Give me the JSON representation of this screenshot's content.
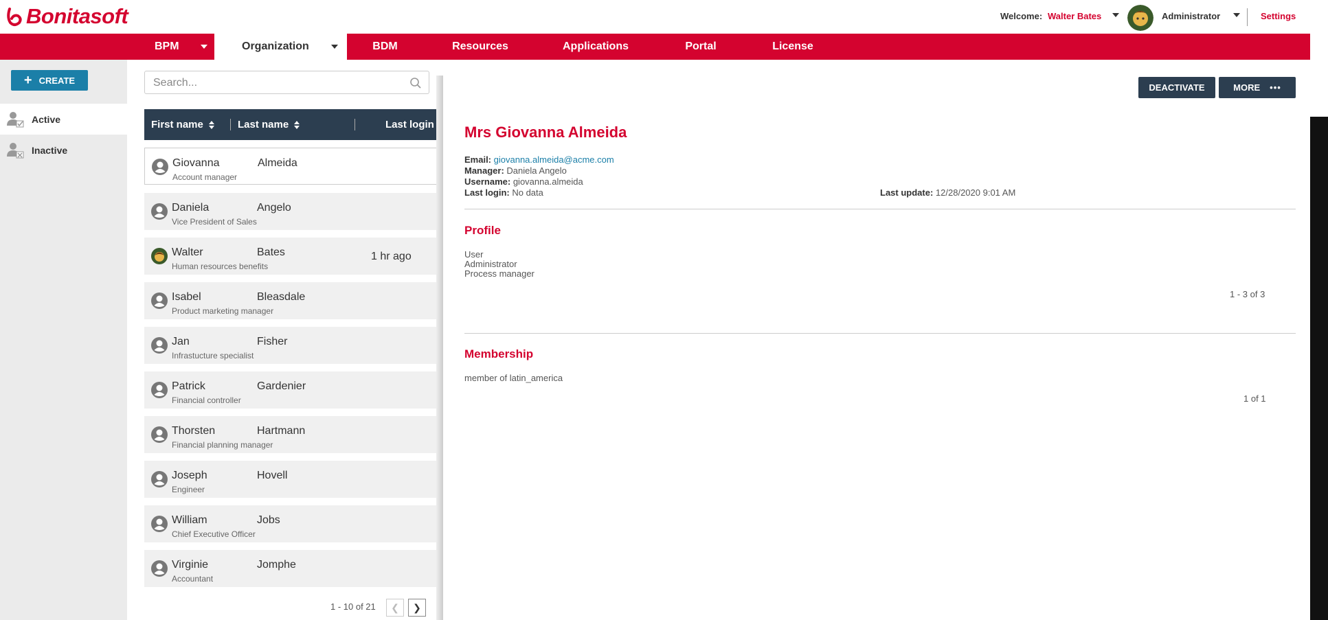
{
  "header": {
    "logo_text": "Bonitasoft",
    "welcome_label": "Welcome:",
    "welcome_user": "Walter Bates",
    "role": "Administrator",
    "settings": "Settings"
  },
  "nav": {
    "items": [
      {
        "label": "BPM"
      },
      {
        "label": "Organization"
      },
      {
        "label": "BDM"
      },
      {
        "label": "Resources"
      },
      {
        "label": "Applications"
      },
      {
        "label": "Portal"
      },
      {
        "label": "License"
      }
    ]
  },
  "sidebar": {
    "create_label": "CREATE",
    "items": [
      {
        "label": "Active"
      },
      {
        "label": "Inactive"
      }
    ]
  },
  "search": {
    "placeholder": "Search...",
    "value": ""
  },
  "table": {
    "columns": [
      "First name",
      "Last name",
      "Last login"
    ],
    "rows": [
      {
        "first": "Giovanna",
        "last": "Almeida",
        "job": "Account manager",
        "last_login": ""
      },
      {
        "first": "Daniela",
        "last": "Angelo",
        "job": "Vice President of Sales",
        "last_login": ""
      },
      {
        "first": "Walter",
        "last": "Bates",
        "job": "Human resources benefits",
        "last_login": "1 hr ago"
      },
      {
        "first": "Isabel",
        "last": "Bleasdale",
        "job": "Product marketing manager",
        "last_login": ""
      },
      {
        "first": "Jan",
        "last": "Fisher",
        "job": "Infrastucture specialist",
        "last_login": ""
      },
      {
        "first": "Patrick",
        "last": "Gardenier",
        "job": "Financial controller",
        "last_login": ""
      },
      {
        "first": "Thorsten",
        "last": "Hartmann",
        "job": "Financial planning manager",
        "last_login": ""
      },
      {
        "first": "Joseph",
        "last": "Hovell",
        "job": "Engineer",
        "last_login": ""
      },
      {
        "first": "William",
        "last": "Jobs",
        "job": "Chief Executive Officer",
        "last_login": ""
      },
      {
        "first": "Virginie",
        "last": "Jomphe",
        "job": "Accountant",
        "last_login": ""
      }
    ],
    "pager": "1 - 10 of 21"
  },
  "detail": {
    "deactivate": "DEACTIVATE",
    "more": "MORE",
    "name": "Mrs Giovanna Almeida",
    "email_label": "Email:",
    "email": "giovanna.almeida@acme.com",
    "manager_label": "Manager:",
    "manager": "Daniela Angelo",
    "username_label": "Username:",
    "username": "giovanna.almeida",
    "last_login_label": "Last login:",
    "last_login": "No data",
    "last_update_label": "Last update:",
    "last_update": "12/28/2020 9:01 AM",
    "profile_title": "Profile",
    "profiles": [
      "User",
      "Administrator",
      "Process manager"
    ],
    "profile_count": "1 - 3 of 3",
    "membership_title": "Membership",
    "membership": "member of latin_america",
    "membership_count": "1 of 1"
  },
  "colors": {
    "brand": "#d4032f",
    "navy": "#2c3e50",
    "accent": "#1b7fa8"
  }
}
